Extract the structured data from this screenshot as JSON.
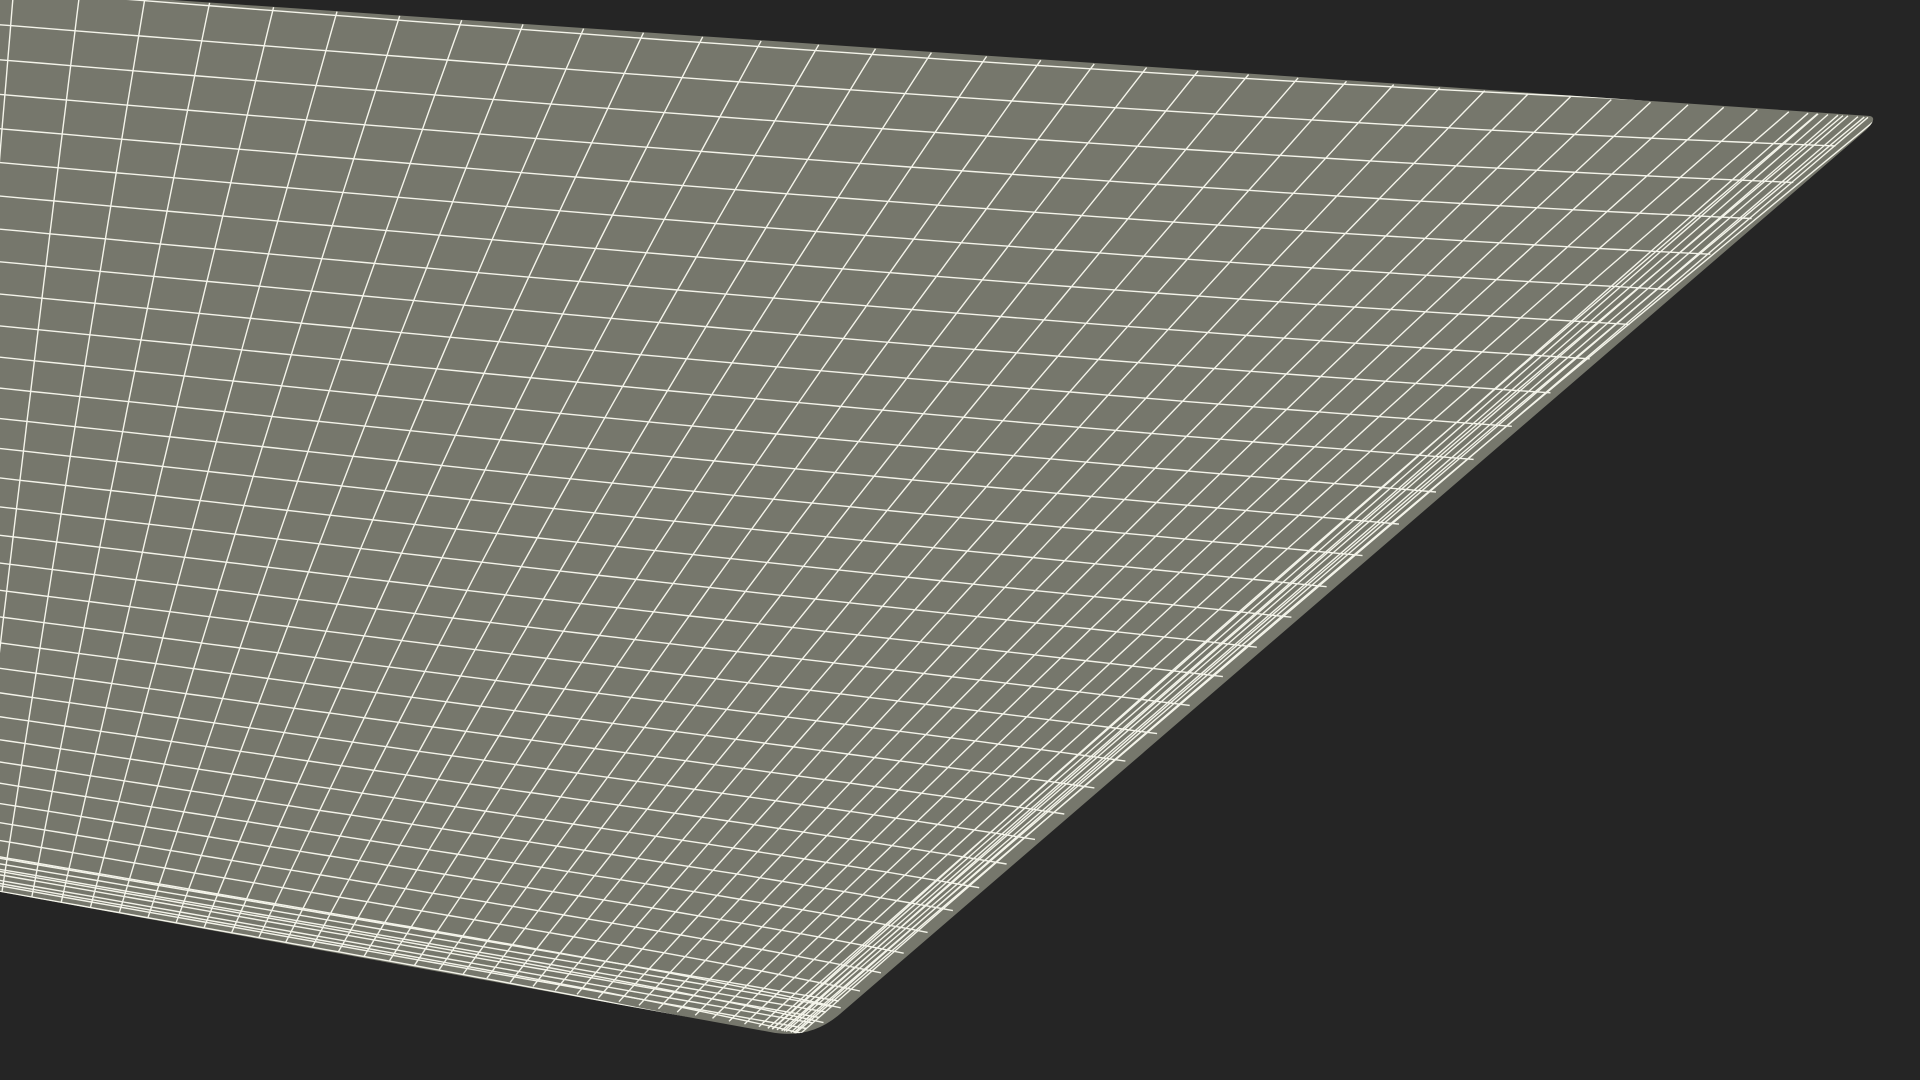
{
  "scene": {
    "background_color": "#252525",
    "surface_color": "#76776c",
    "wireframe_color": "#f4f4ea",
    "object": "wireframe-mesh-surface",
    "view": "perspective"
  }
}
